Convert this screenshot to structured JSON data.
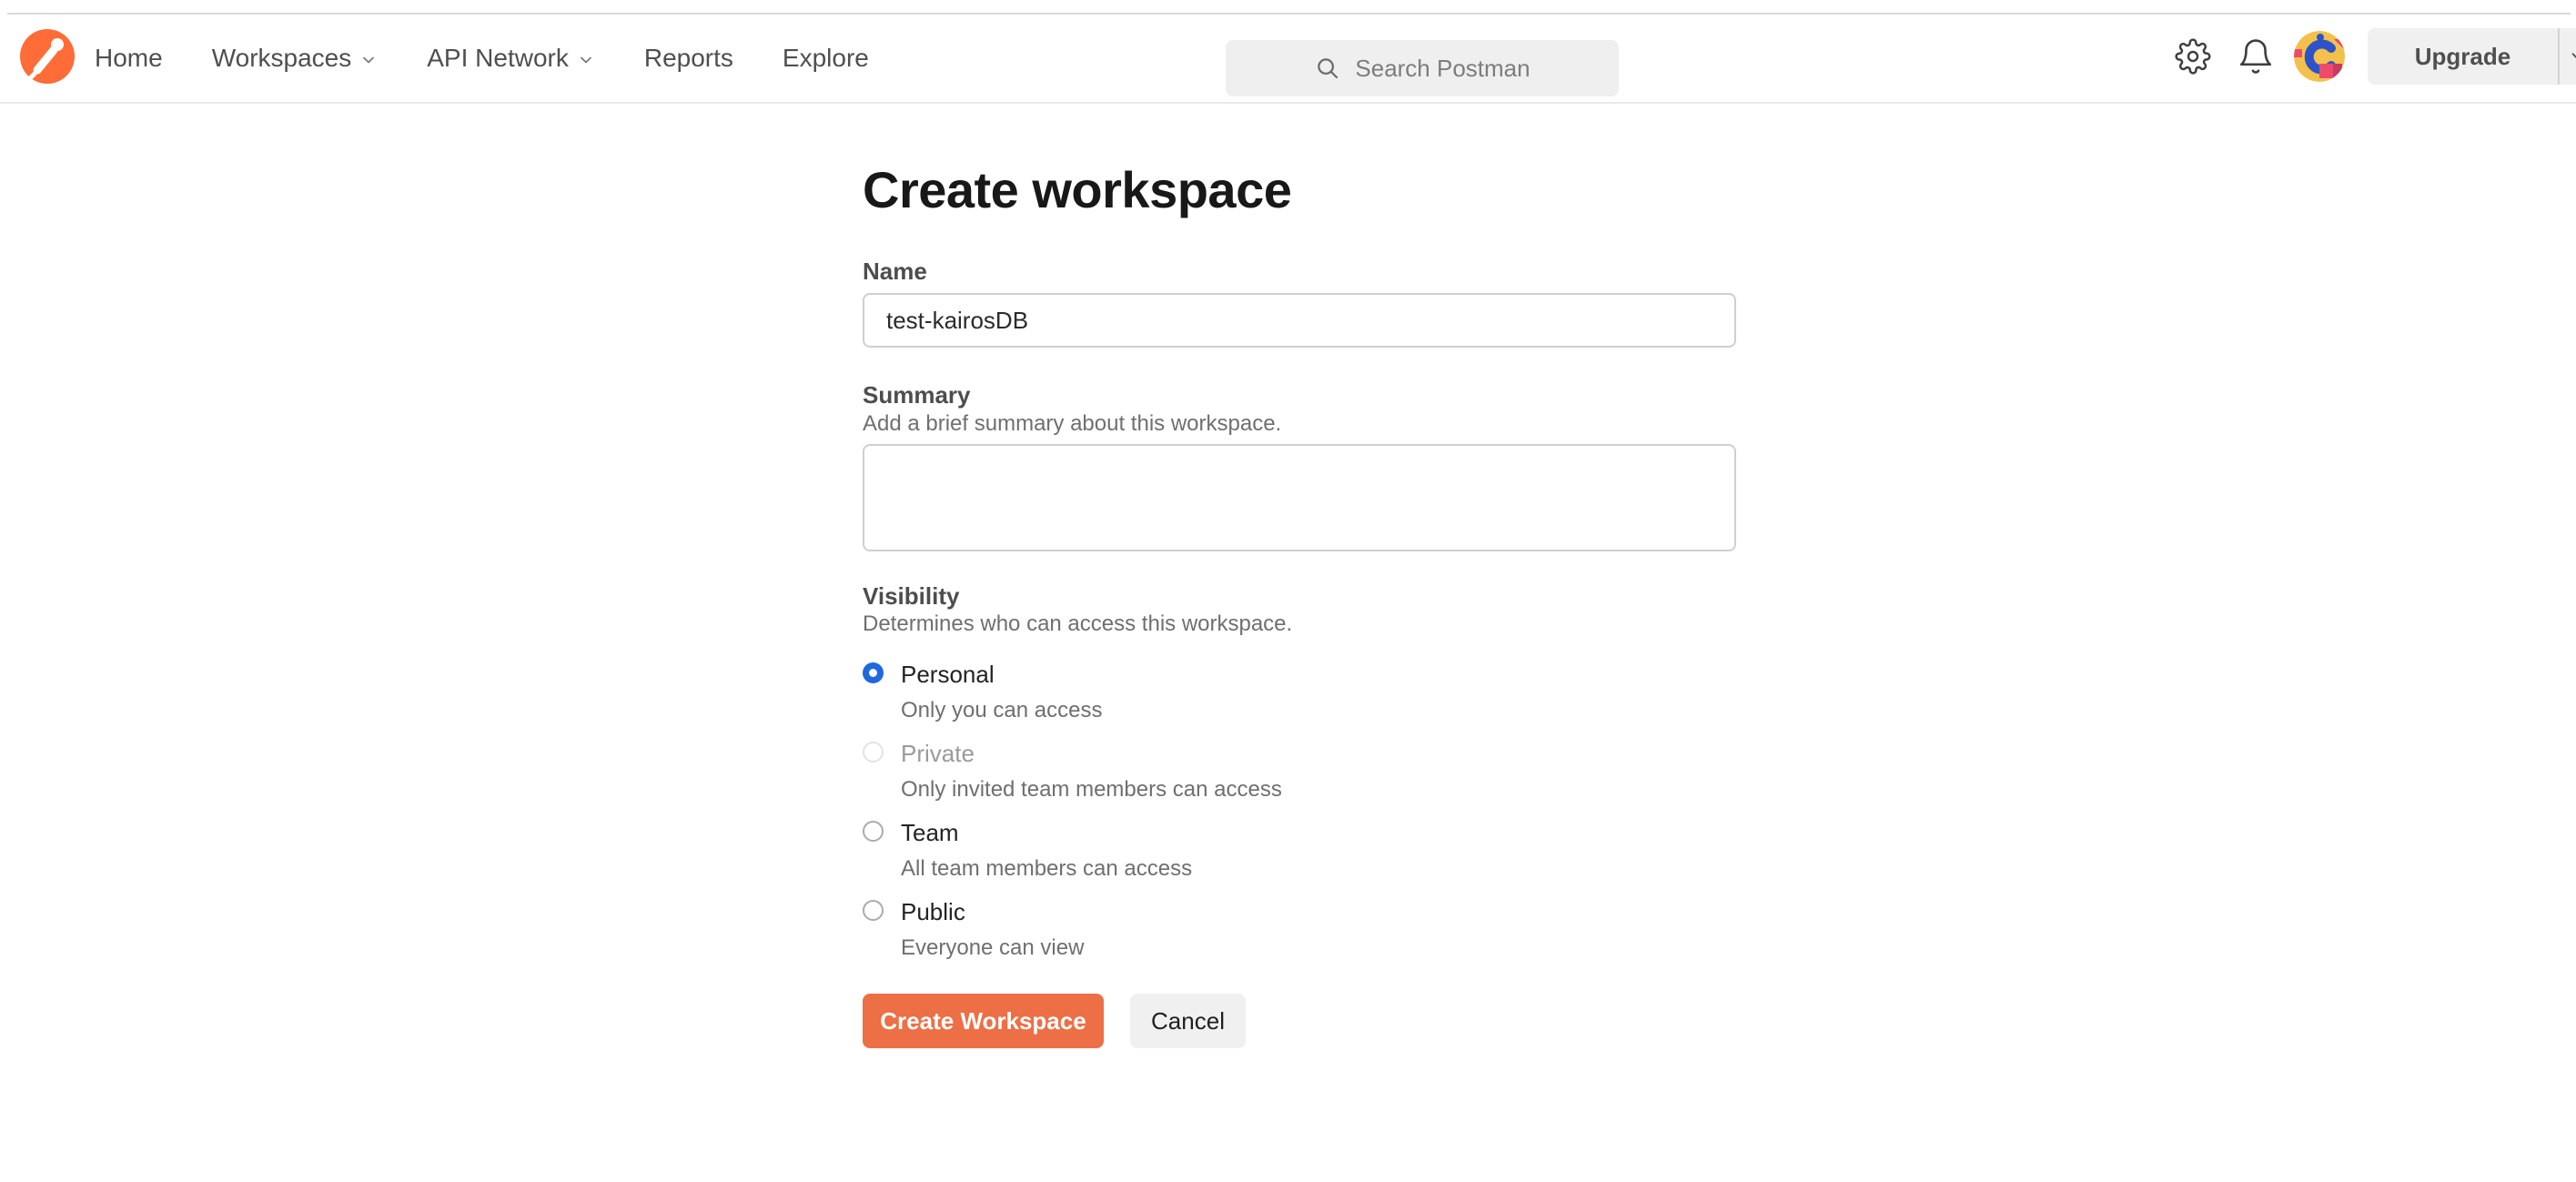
{
  "topbar": {
    "logo_icon": "postman-logo",
    "nav": [
      {
        "label": "Home",
        "has_caret": false
      },
      {
        "label": "Workspaces",
        "has_caret": true
      },
      {
        "label": "API Network",
        "has_caret": true
      },
      {
        "label": "Reports",
        "has_caret": false
      },
      {
        "label": "Explore",
        "has_caret": false
      }
    ],
    "search": {
      "placeholder": "Search Postman",
      "icon": "search-icon"
    },
    "right_icons": [
      "settings-gear-icon",
      "notifications-bell-icon",
      "user-avatar"
    ],
    "upgrade": {
      "label": "Upgrade",
      "caret_icon": "chevron-down-icon"
    }
  },
  "page": {
    "title": "Create workspace",
    "fields": {
      "name": {
        "label": "Name",
        "value": "test-kairosDB"
      },
      "summary": {
        "label": "Summary",
        "help": "Add a brief summary about this workspace.",
        "value": ""
      }
    },
    "visibility": {
      "label": "Visibility",
      "help": "Determines who can access this workspace.",
      "options": [
        {
          "label": "Personal",
          "description": "Only you can access",
          "selected": true,
          "disabled": false
        },
        {
          "label": "Private",
          "description": "Only invited team members can access",
          "selected": false,
          "disabled": true
        },
        {
          "label": "Team",
          "description": "All team members can access",
          "selected": false,
          "disabled": false
        },
        {
          "label": "Public",
          "description": "Everyone can view",
          "selected": false,
          "disabled": false
        }
      ]
    },
    "actions": {
      "submit_label": "Create Workspace",
      "cancel_label": "Cancel"
    }
  },
  "colors": {
    "brand_orange": "#FF6C37",
    "primary_button_orange": "#ED6F45",
    "radio_selected_blue": "#1F68DD",
    "topbar_border": "#E9E9E9",
    "control_bg_gray": "#F0F0F0",
    "muted_text": "#6F6F6F"
  }
}
